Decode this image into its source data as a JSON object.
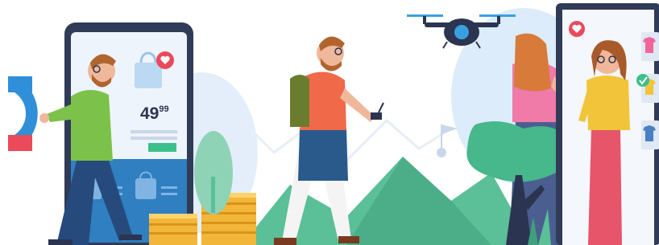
{
  "illustration": {
    "price": {
      "integer": "49",
      "decimal": "99"
    },
    "colors": {
      "sky_blob": "#dcecfa",
      "hill": "#5bbf98",
      "hill_dark": "#3fa07c",
      "phone_body": "#2f3b57",
      "phone_screen": "#eef4fb",
      "phone_panel": "#2f7fc1",
      "accent_red": "#ea4a5a",
      "accent_green": "#3cbf8a",
      "coin": "#f2b63a",
      "coin_shade": "#d99418",
      "drone": "#2b3450",
      "drone_lens": "#39a0e0",
      "tree": "#46b88c"
    },
    "icons": [
      "shopping-bag-icon",
      "heart-icon",
      "check-icon",
      "tshirt-icon",
      "flag-icon"
    ]
  }
}
